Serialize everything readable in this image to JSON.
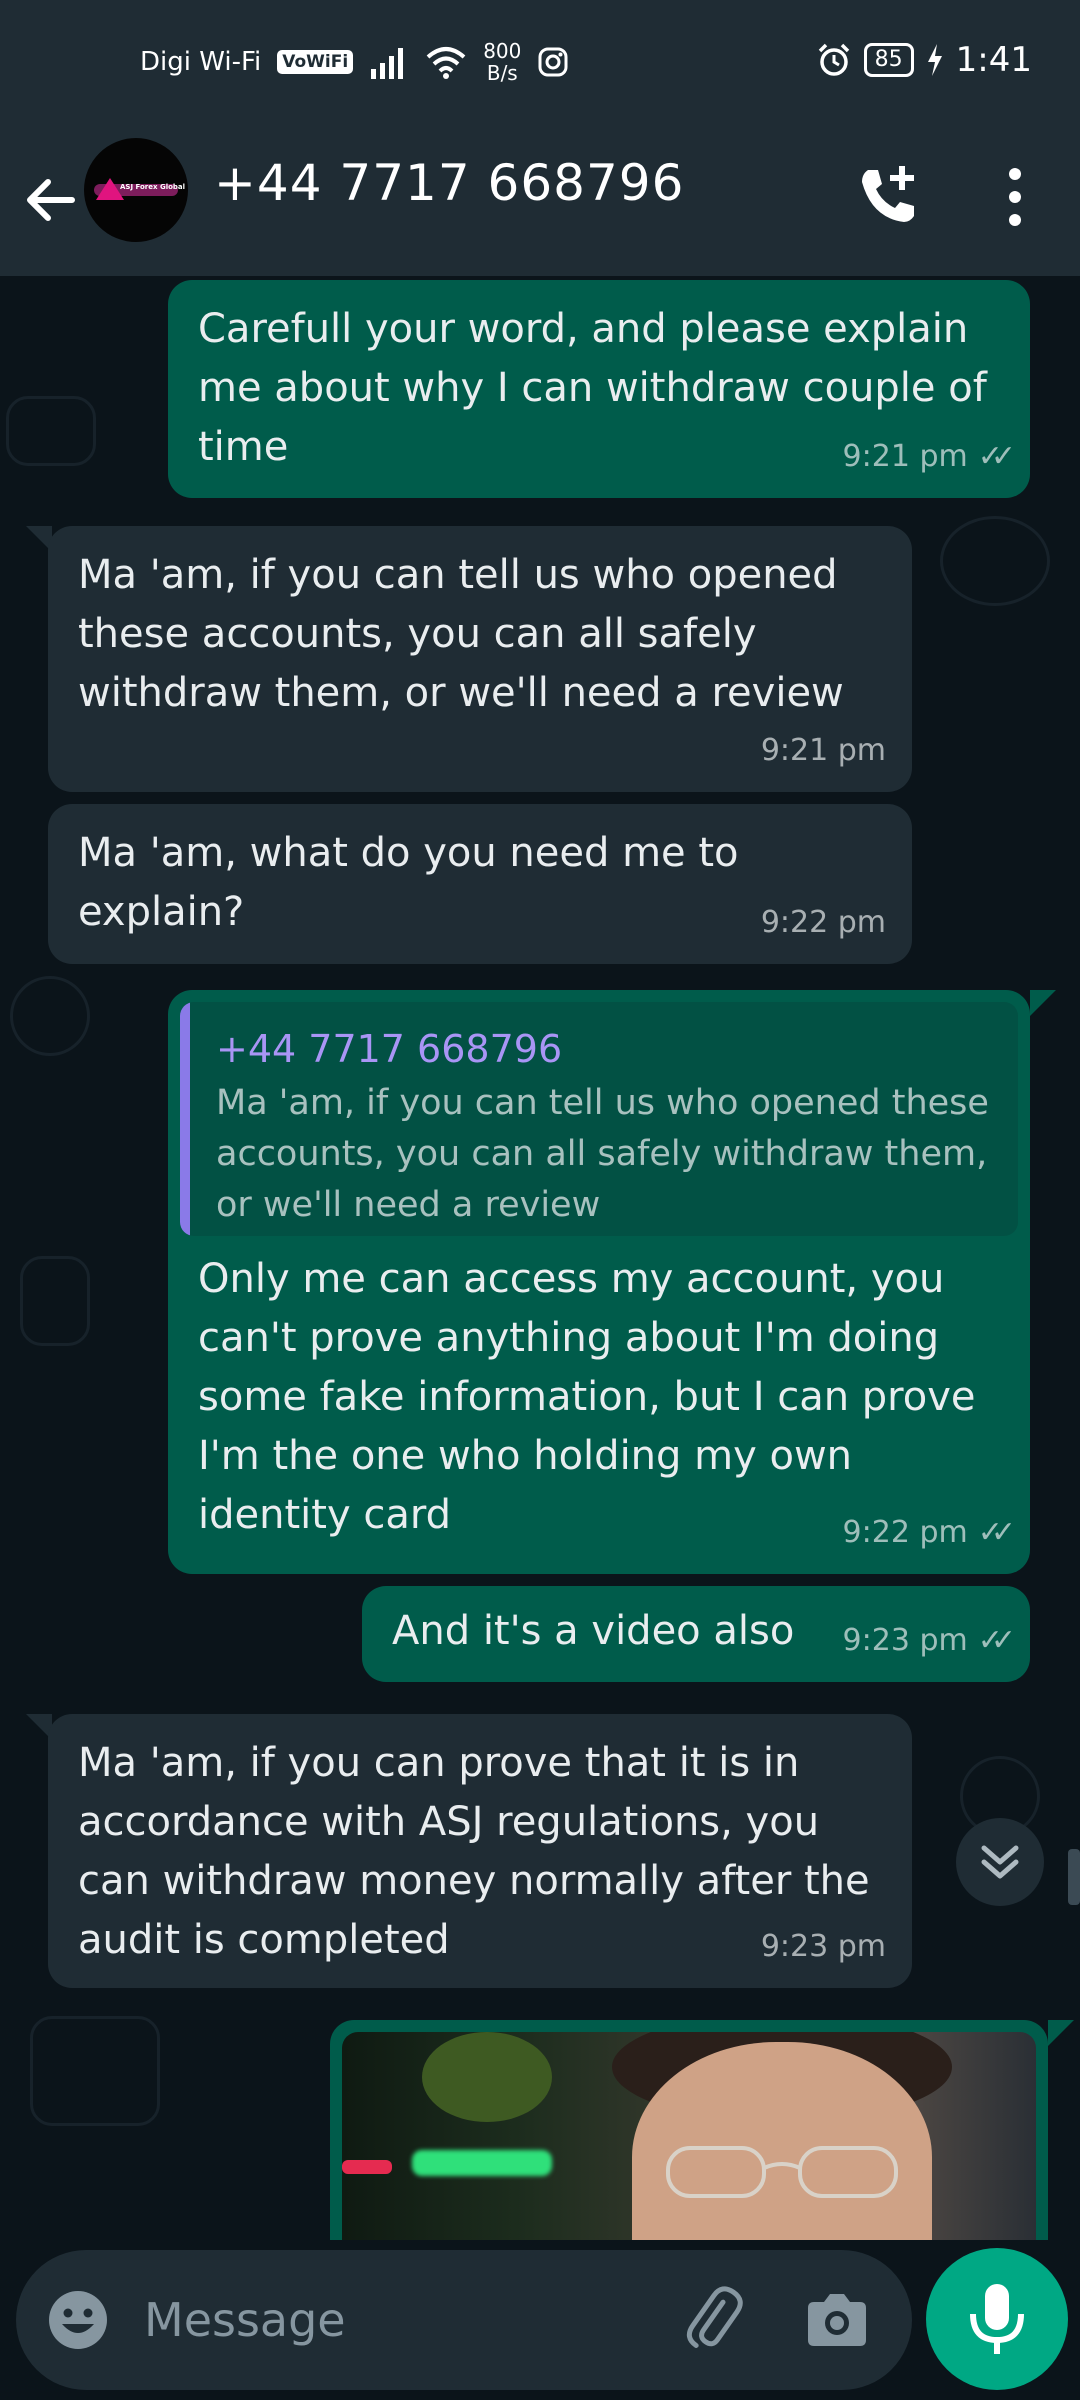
{
  "status_bar": {
    "carrier": "Digi Wi-Fi",
    "vowifi": "VoWiFi",
    "speed_value": "800",
    "speed_unit": "B/s",
    "battery": "85",
    "time": "1:41"
  },
  "header": {
    "avatar_logo_text": "ASJ Forex Global",
    "contact_name": "+44 7717 668796"
  },
  "messages": [
    {
      "direction": "out",
      "text": "Carefull your word, and please explain me about why I can withdraw couple of time",
      "time": "9:21 pm",
      "status": "read"
    },
    {
      "direction": "in",
      "text": "Ma 'am, if you can tell us who opened these accounts, you can all safely withdraw them, or we'll need a review",
      "time": "9:21 pm"
    },
    {
      "direction": "in",
      "text": "Ma 'am, what do you need me to explain?",
      "time": "9:22 pm"
    },
    {
      "direction": "out",
      "quote": {
        "author": "+44 7717 668796",
        "text": "Ma 'am, if you can tell us who opened these accounts, you can all safely withdraw them, or we'll need a review"
      },
      "text": "Only me can access my account, you can't prove anything about I'm doing some fake information, but I can prove I'm the one who holding my own identity card",
      "time": "9:22 pm",
      "status": "read"
    },
    {
      "direction": "out",
      "text": "And it's a video also",
      "time": "9:23 pm",
      "status": "read"
    },
    {
      "direction": "in",
      "text": "Ma 'am, if you can prove that it is in accordance with ASJ regulations, you can withdraw money normally after the audit is completed",
      "time": "9:23 pm"
    }
  ],
  "composer": {
    "placeholder": "Message"
  },
  "icons": {
    "back": "arrow-left-icon",
    "call": "add-call-icon",
    "menu": "more-vert-icon",
    "emoji": "emoji-icon",
    "attach": "paperclip-icon",
    "camera": "camera-icon",
    "mic": "mic-icon",
    "scroll": "double-chevron-down-icon"
  },
  "colors": {
    "header_bg": "#1f2c34",
    "chat_bg": "#0b141a",
    "outgoing_bubble": "#005c4b",
    "incoming_bubble": "#1f2c34",
    "accent": "#00a884",
    "quote_author": "#a995f5"
  }
}
